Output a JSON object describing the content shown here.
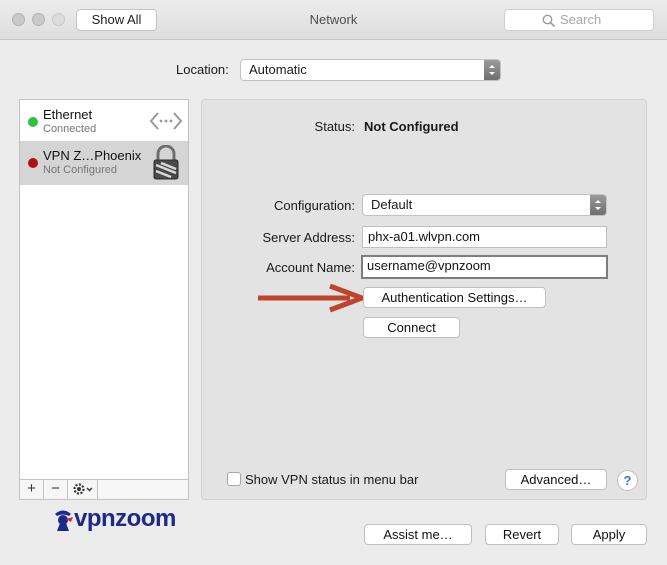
{
  "window": {
    "title": "Network",
    "show_all_label": "Show All",
    "search_placeholder": "Search"
  },
  "location": {
    "label": "Location:",
    "value": "Automatic"
  },
  "services": [
    {
      "name": "Ethernet",
      "status": "Connected",
      "status_color": "#2ec13f",
      "icon": "ethernet-arrows-icon"
    },
    {
      "name": "VPN Z…Phoenix",
      "status": "Not Configured",
      "status_color": "#b10f13",
      "icon": "vpn-lock-icon",
      "selected": true
    }
  ],
  "list_buttons": {
    "add": "+",
    "remove": "−",
    "gear": "gear-icon"
  },
  "detail": {
    "status_label": "Status:",
    "status_value": "Not Configured",
    "configuration_label": "Configuration:",
    "configuration_value": "Default",
    "server_label": "Server Address:",
    "server_value": "phx-a01.wlvpn.com",
    "account_label": "Account Name:",
    "account_value": "username@vpnzoom",
    "auth_button": "Authentication Settings…",
    "connect_button": "Connect",
    "show_status_label": "Show VPN status in menu bar",
    "show_status_checked": false,
    "advanced_button": "Advanced…",
    "help_button": "?"
  },
  "footer": {
    "logo_text": "vpnzoom",
    "assist_button": "Assist me…",
    "revert_button": "Revert",
    "apply_button": "Apply"
  },
  "annotation": {
    "arrow_color": "#c0432b"
  }
}
